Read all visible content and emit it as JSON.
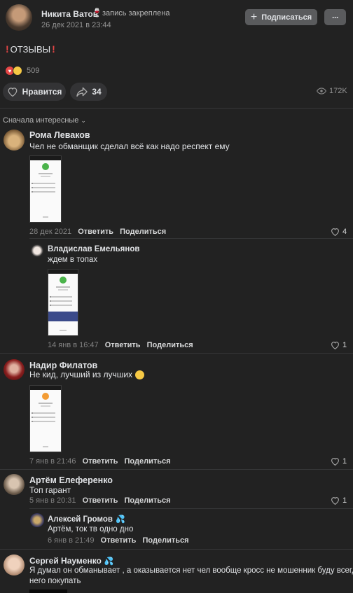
{
  "post": {
    "author": "Никита Ватов",
    "pinned": "запись закреплена",
    "date": "26 дек 2021 в 23:44",
    "subscribe": "Подписаться",
    "more": "···",
    "title": "ОТЗЫВЫ",
    "reactions_count": "509",
    "like_label": "Нравится",
    "share_count": "34",
    "views": "172K"
  },
  "sort_label": "Сначала интересные",
  "actions": {
    "reply": "Ответить",
    "share": "Поделиться"
  },
  "comments": [
    {
      "name": "Рома Леваков",
      "text": "Чел не обманщик сделал всё как надо респект ему",
      "date": "28 дек 2021",
      "likes": "4"
    },
    {
      "name": "Владислав Емельянов",
      "text": "ждем в топах",
      "date": "14 янв в 16:47",
      "likes": "1"
    },
    {
      "name": "Надир Филатов",
      "text": "Не кид, лучший из лучших",
      "date": "7 янв в 21:46",
      "likes": "1"
    },
    {
      "name": "Артём Елеференко",
      "text": "Топ гарант",
      "date": "5 янв в 20:31",
      "likes": "1"
    },
    {
      "name": "Алексей Громов",
      "text": "Артём, ток тв одно дно",
      "date": "6 янв в 21:49",
      "likes": ""
    },
    {
      "name": "Сергей Науменко",
      "text": "Я думал он обманывает , а оказывается нет чел вообще кросс не мошенник буду всегда у",
      "text2": "него покупать",
      "date": "",
      "likes": ""
    }
  ],
  "colors": {
    "background": "#222222",
    "accent": "#e64646",
    "like_button": "#333335",
    "subscribe_button": "#5a5b5d"
  },
  "icons": [
    "plus-icon",
    "eye-icon",
    "heart-icon",
    "share-icon",
    "chevron-down-icon",
    "exclamation-icon",
    "wine-glass-icon",
    "emoji-icon",
    "droplets-icon"
  ]
}
